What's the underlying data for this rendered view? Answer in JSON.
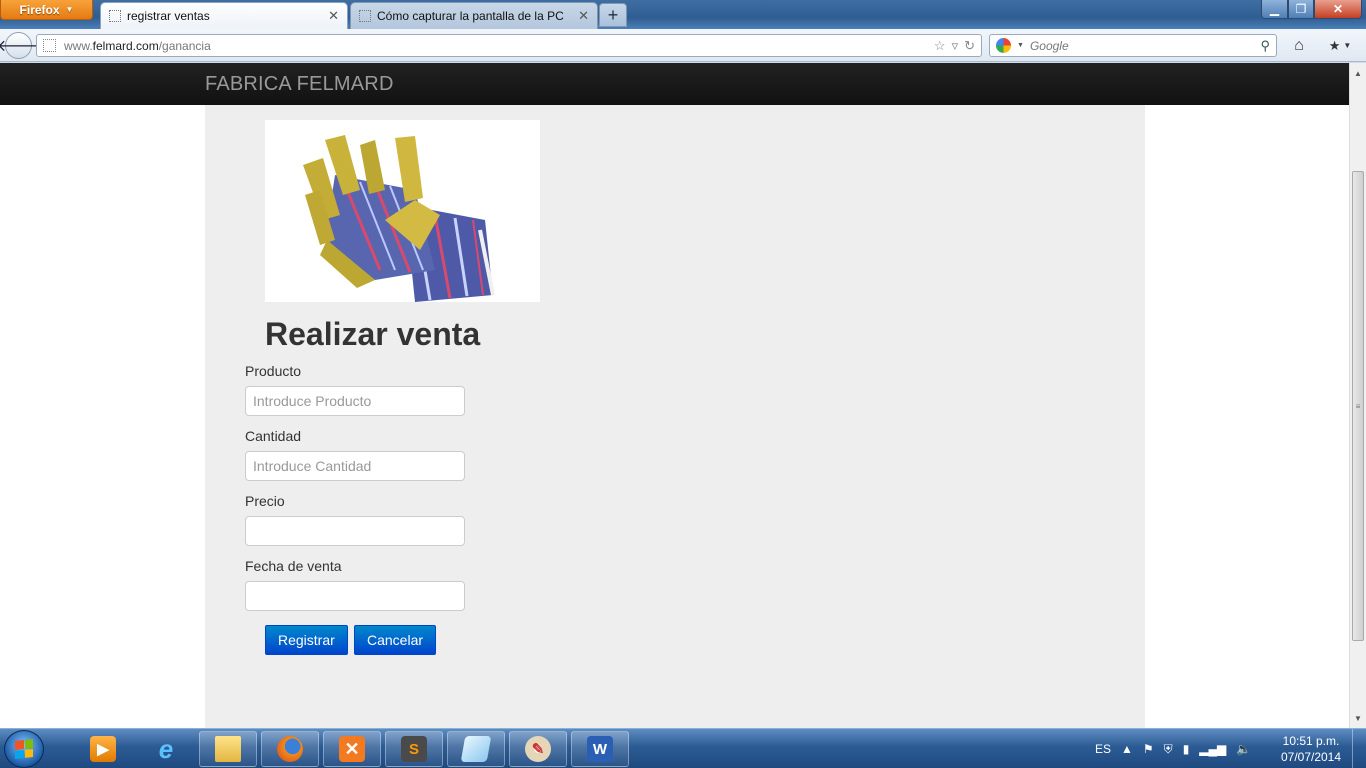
{
  "browser": {
    "app_button": "Firefox",
    "tabs": [
      {
        "title": "registrar ventas",
        "active": true
      },
      {
        "title": "Cómo capturar la pantalla de la PC",
        "active": false
      }
    ],
    "new_tab_label": "+",
    "url_prefix": "www.",
    "url_domain": "felmard.com",
    "url_path": "/ganancia",
    "search_placeholder": "Google"
  },
  "site": {
    "brand": "FABRICA FELMARD"
  },
  "form": {
    "title": "Realizar venta",
    "fields": [
      {
        "label": "Producto",
        "placeholder": "Introduce Producto",
        "value": ""
      },
      {
        "label": "Cantidad",
        "placeholder": "Introduce Cantidad",
        "value": ""
      },
      {
        "label": "Precio",
        "placeholder": "",
        "value": ""
      },
      {
        "label": "Fecha de venta",
        "placeholder": "",
        "value": ""
      }
    ],
    "submit_label": "Registrar",
    "cancel_label": "Cancelar"
  },
  "taskbar": {
    "language": "ES",
    "time": "10:51 p.m.",
    "date": "07/07/2014",
    "pinned_apps": [
      "media-player-icon",
      "internet-explorer-icon",
      "file-explorer-icon",
      "firefox-icon",
      "xampp-icon",
      "sublime-text-icon",
      "notepad-icon",
      "paint-icon",
      "word-icon"
    ]
  },
  "colors": {
    "accent": "#0055cc",
    "navbar": "#1b1b1b",
    "container": "#eeeeee"
  }
}
